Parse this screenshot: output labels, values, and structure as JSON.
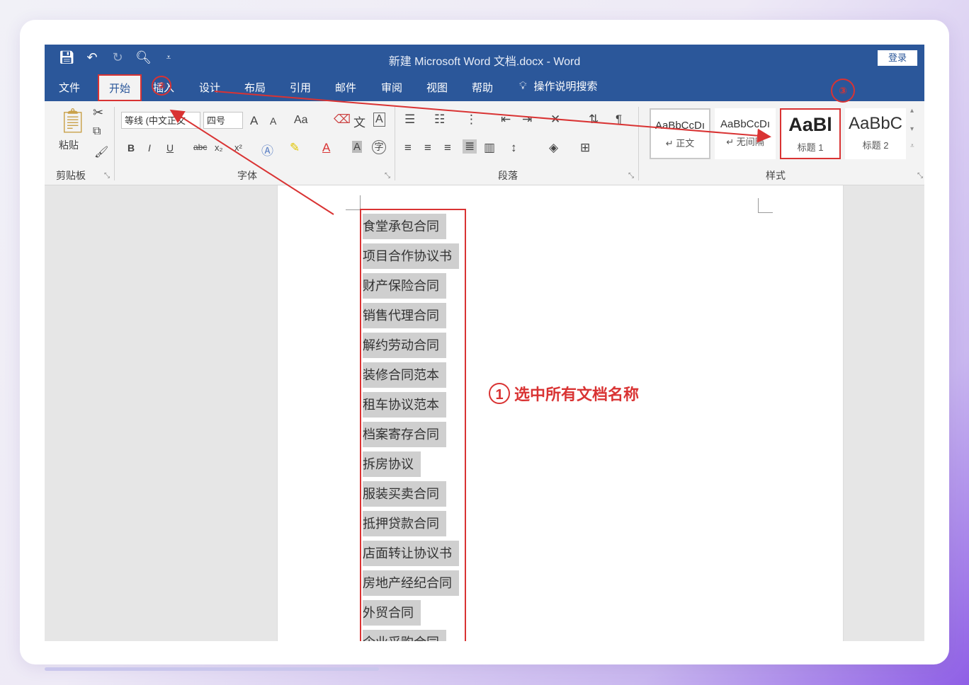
{
  "window": {
    "title": "新建 Microsoft Word 文档.docx  -  Word",
    "login_label": "登录"
  },
  "quick_access": [
    "save-icon",
    "undo-icon",
    "redo-icon",
    "print-preview-icon",
    "customize-icon"
  ],
  "tabs": [
    {
      "id": "file",
      "label": "文件"
    },
    {
      "id": "home",
      "label": "开始",
      "active": true
    },
    {
      "id": "insert",
      "label": "插入"
    },
    {
      "id": "design",
      "label": "设计"
    },
    {
      "id": "layout",
      "label": "布局"
    },
    {
      "id": "references",
      "label": "引用"
    },
    {
      "id": "mailings",
      "label": "邮件"
    },
    {
      "id": "review",
      "label": "审阅"
    },
    {
      "id": "view",
      "label": "视图"
    },
    {
      "id": "help",
      "label": "帮助"
    }
  ],
  "tell_me": "操作说明搜索",
  "ribbon": {
    "clipboard": {
      "paste_label": "粘贴",
      "group_label": "剪贴板"
    },
    "font": {
      "font_name": "等线 (中文正文",
      "font_size": "四号",
      "grow": "A",
      "shrink": "A",
      "case": "Aa",
      "phonetic": "文",
      "border": "A",
      "bold": "B",
      "italic": "I",
      "underline": "U",
      "strike": "abc",
      "sub": "x₂",
      "sup": "x²",
      "font_color": "A",
      "char_shading": "A",
      "enclose": "字",
      "group_label": "字体"
    },
    "paragraph": {
      "group_label": "段落"
    },
    "styles": {
      "group_label": "样式",
      "items": [
        {
          "sample": "AaBbCcDı",
          "name": "↵ 正文"
        },
        {
          "sample": "AaBbCcDı",
          "name": "↵ 无间隔"
        },
        {
          "sample": "AaBl",
          "name": "标题 1"
        },
        {
          "sample": "AaBbC",
          "name": "标题 2"
        }
      ]
    }
  },
  "document": {
    "lines": [
      "食堂承包合同",
      "项目合作协议书",
      "财产保险合同",
      "销售代理合同",
      "解约劳动合同",
      "装修合同范本",
      "租车协议范本",
      "档案寄存合同",
      "拆房协议",
      "服装买卖合同",
      "抵押贷款合同",
      "店面转让协议书",
      "房地产经纪合同",
      "外贸合同",
      "企业采购合同"
    ]
  },
  "annotations": {
    "step1_number": "1",
    "step1_text": "选中所有文档名称",
    "step2_number": "②",
    "step3_number": "③"
  },
  "colors": {
    "word_blue": "#2b579a",
    "annotation_red": "#d93333",
    "selection_gray": "#cfcfcf"
  }
}
